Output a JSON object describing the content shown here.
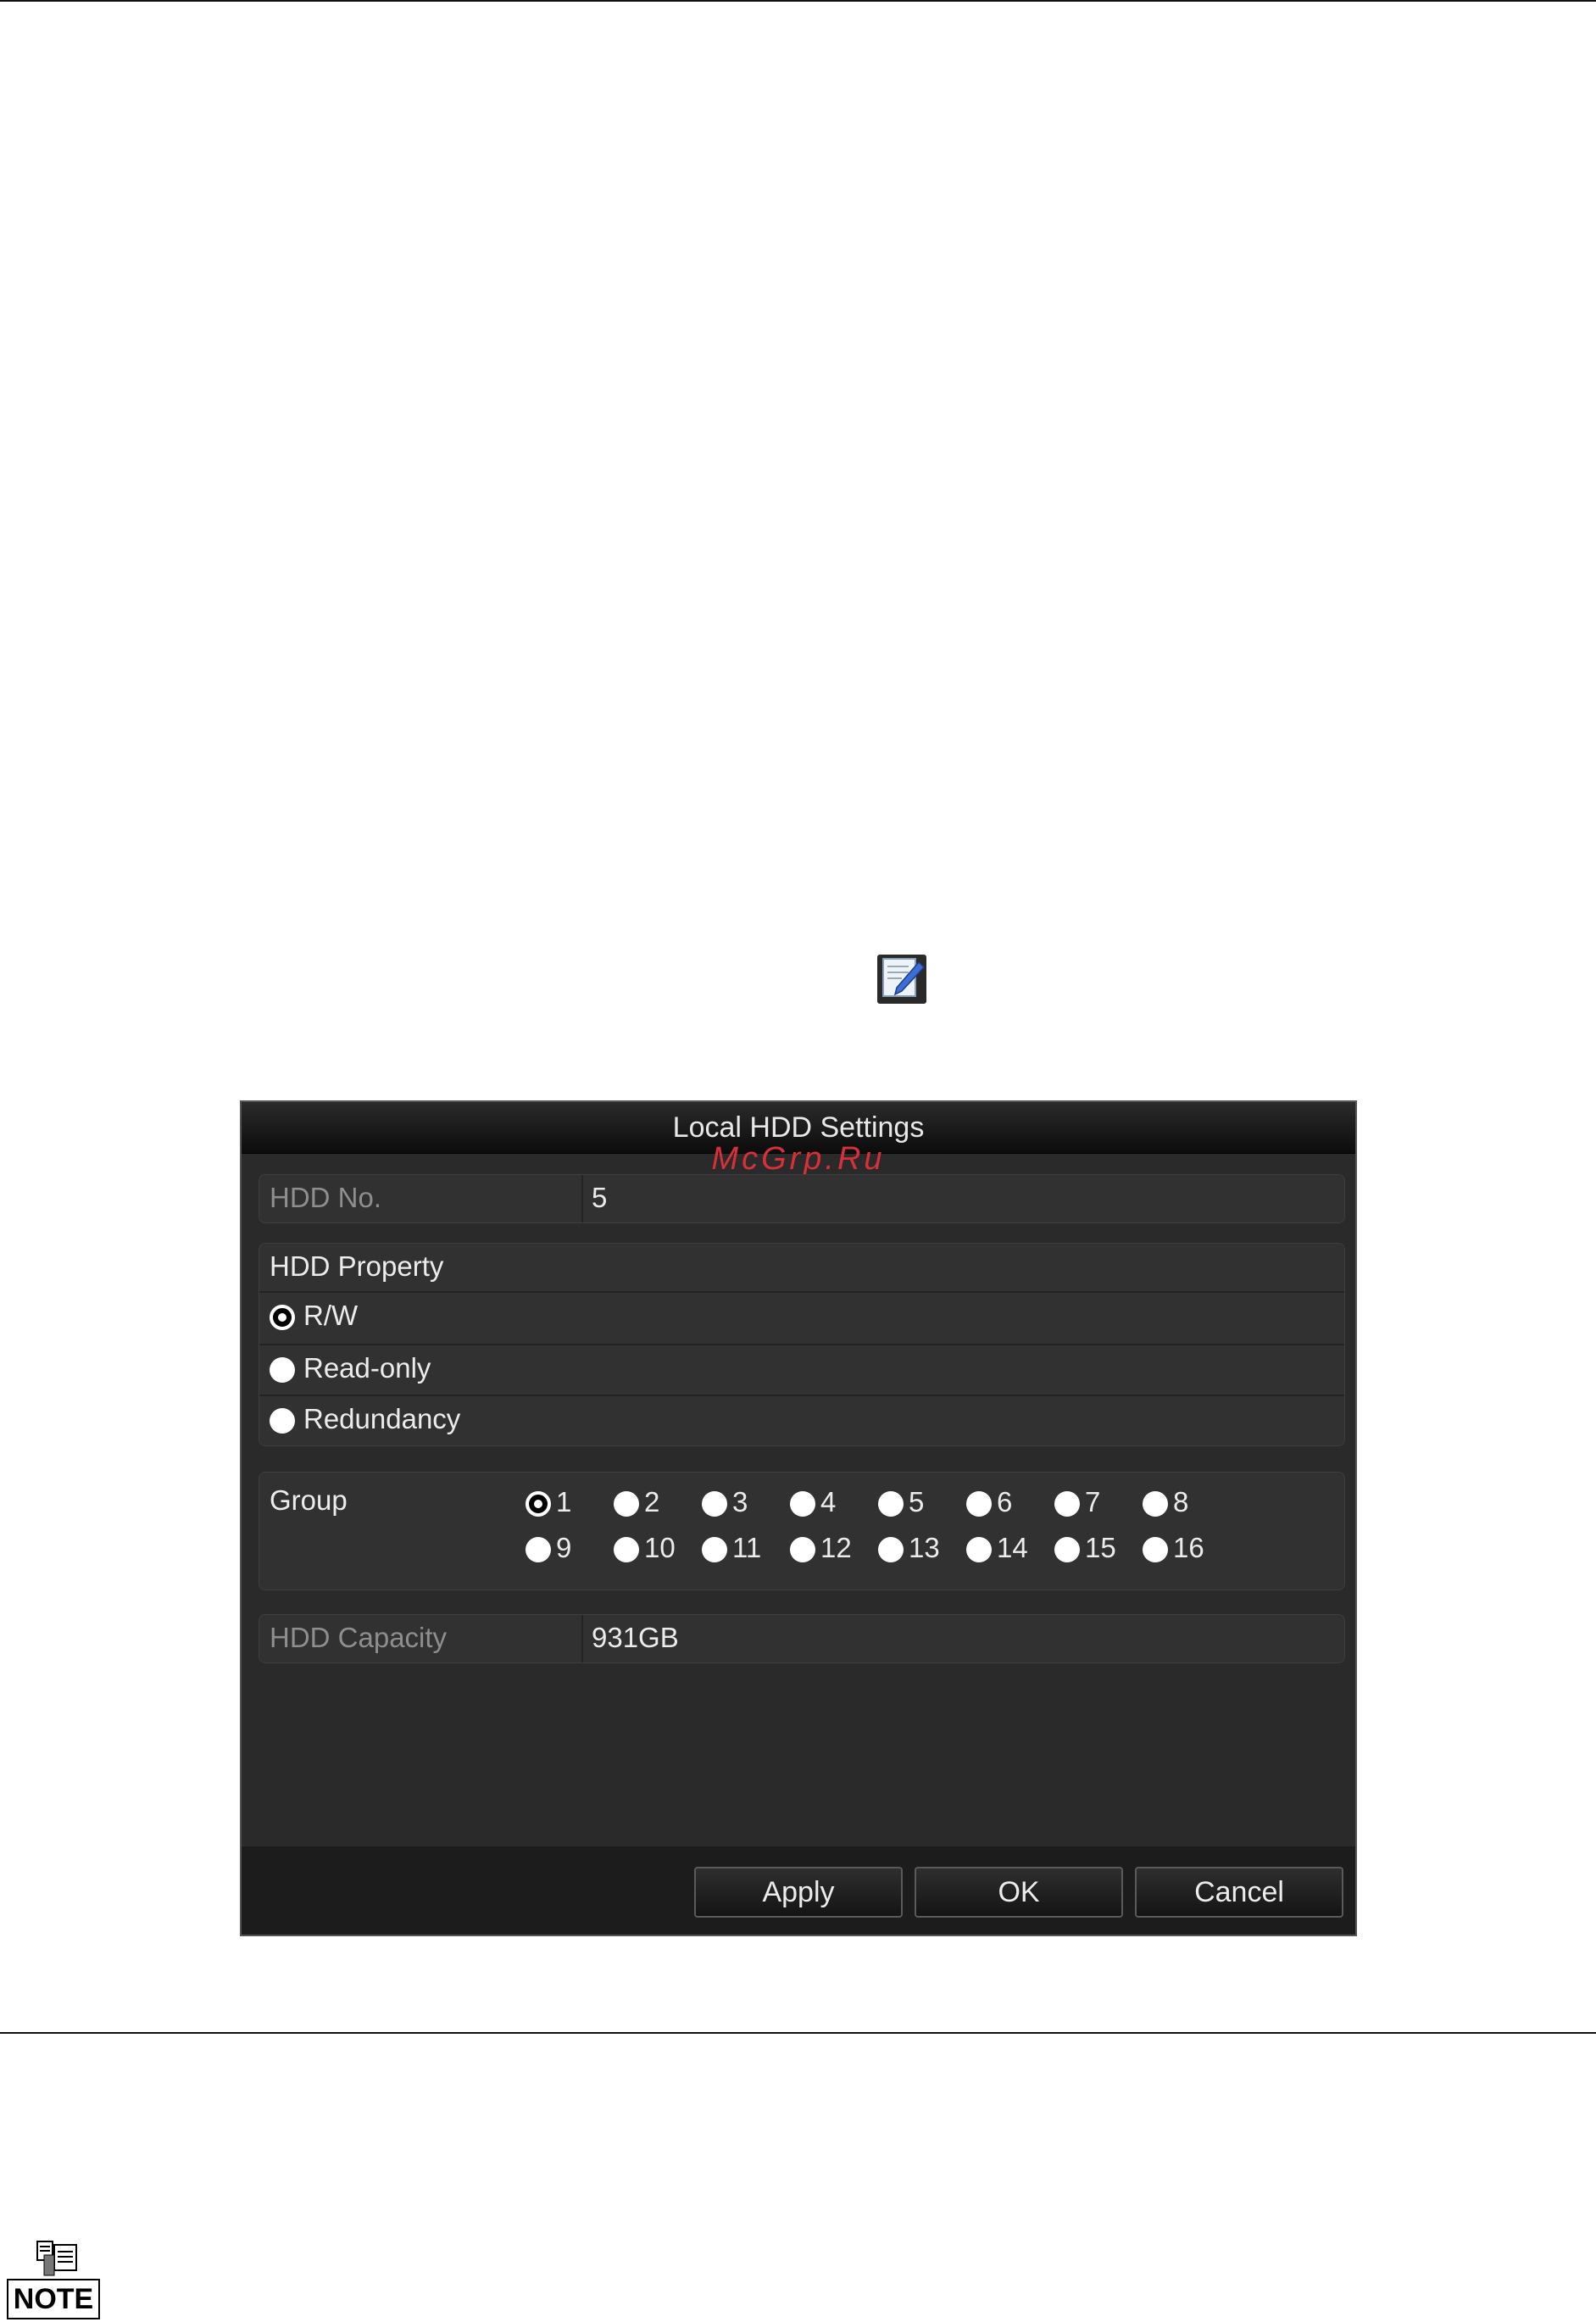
{
  "dialog": {
    "title": "Local HDD Settings",
    "watermark": "McGrp.Ru",
    "hdd_no": {
      "label": "HDD No.",
      "value": "5"
    },
    "hdd_property": {
      "label": "HDD Property",
      "options": [
        "R/W",
        "Read-only",
        "Redundancy"
      ],
      "selected": "R/W"
    },
    "group": {
      "label": "Group",
      "options": [
        "1",
        "2",
        "3",
        "4",
        "5",
        "6",
        "7",
        "8",
        "9",
        "10",
        "11",
        "12",
        "13",
        "14",
        "15",
        "16"
      ],
      "selected": "1"
    },
    "hdd_capacity": {
      "label": "HDD Capacity",
      "value": "931GB"
    },
    "buttons": {
      "apply": "Apply",
      "ok": "OK",
      "cancel": "Cancel"
    }
  },
  "note": {
    "label": "NOTE"
  },
  "icons": {
    "edit": "edit-icon",
    "note": "note-icon"
  }
}
